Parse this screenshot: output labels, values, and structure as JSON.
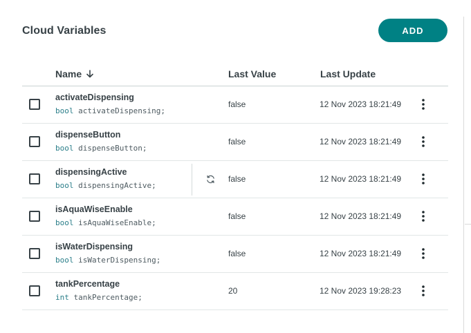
{
  "header": {
    "title": "Cloud Variables",
    "add_label": "ADD"
  },
  "table": {
    "columns": {
      "name": "Name",
      "last_value": "Last Value",
      "last_update": "Last Update"
    },
    "rows": [
      {
        "name": "activateDispensing",
        "type": "bool",
        "decl": "activateDispensing;",
        "value": "false",
        "updated": "12 Nov 2023 18:21:49"
      },
      {
        "name": "dispenseButton",
        "type": "bool",
        "decl": "dispenseButton;",
        "value": "false",
        "updated": "12 Nov 2023 18:21:49"
      },
      {
        "name": "dispensingActive",
        "type": "bool",
        "decl": "dispensingActive;",
        "value": "false",
        "updated": "12 Nov 2023 18:21:49"
      },
      {
        "name": "isAquaWiseEnable",
        "type": "bool",
        "decl": "isAquaWiseEnable;",
        "value": "false",
        "updated": "12 Nov 2023 18:21:49"
      },
      {
        "name": "isWaterDispensing",
        "type": "bool",
        "decl": "isWaterDispensing;",
        "value": "false",
        "updated": "12 Nov 2023 18:21:49"
      },
      {
        "name": "tankPercentage",
        "type": "int",
        "decl": "tankPercentage;",
        "value": "20",
        "updated": "12 Nov 2023 19:28:23"
      }
    ]
  },
  "colors": {
    "accent": "#008184",
    "text": "#374146"
  },
  "icons": {
    "sort": "arrow-down-icon",
    "sync": "sync-icon",
    "row_menu": "vertical-dots-icon"
  }
}
